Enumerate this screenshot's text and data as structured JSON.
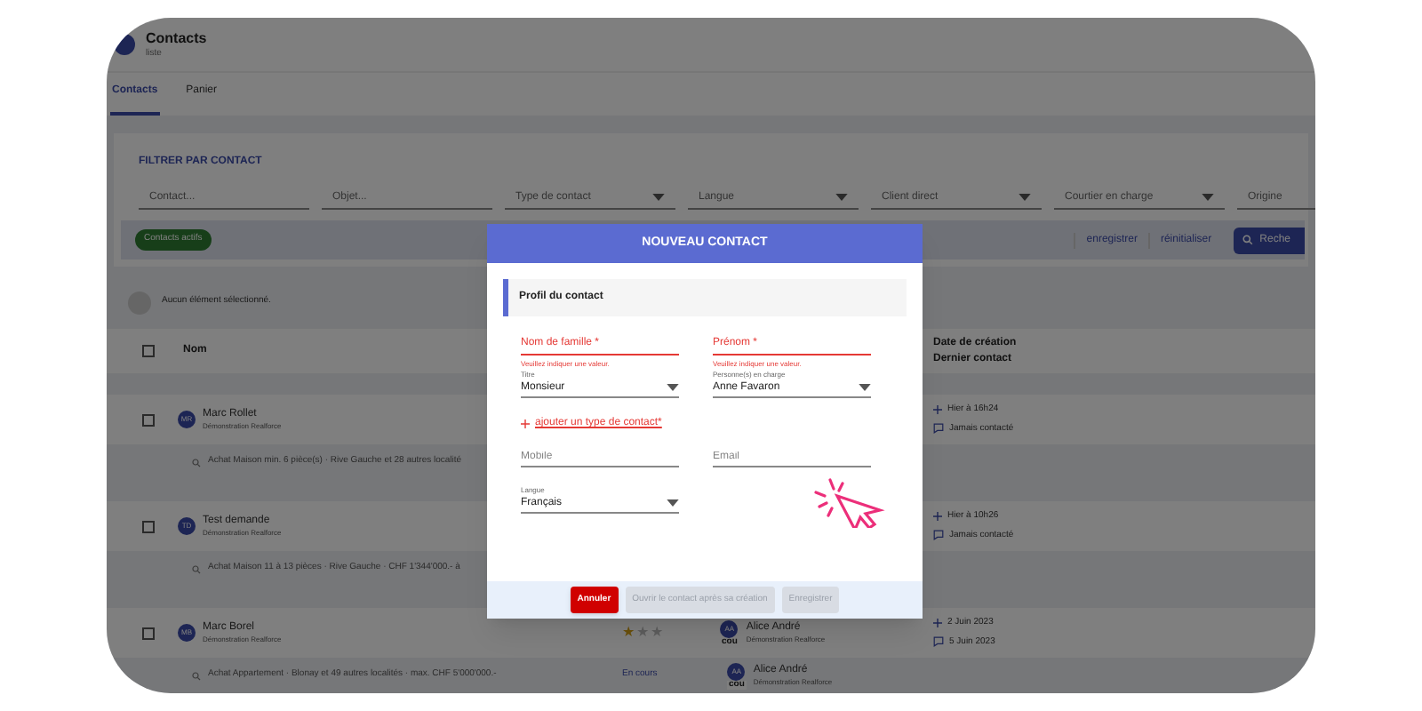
{
  "app": {
    "title": "Contacts",
    "subtitle": "liste"
  },
  "tabs": [
    {
      "label": "Contacts",
      "selected": true
    },
    {
      "label": "Panier",
      "selected": false
    }
  ],
  "filters": {
    "title": "FILTRER PAR CONTACT",
    "fields": [
      {
        "kind": "input",
        "placeholder": "Contact..."
      },
      {
        "kind": "input",
        "placeholder": "Objet..."
      },
      {
        "kind": "select",
        "placeholder": "Type de contact"
      },
      {
        "kind": "select",
        "placeholder": "Langue"
      },
      {
        "kind": "select",
        "placeholder": "Client direct"
      },
      {
        "kind": "select",
        "placeholder": "Courtier en charge"
      },
      {
        "kind": "input",
        "placeholder": "Origine"
      }
    ],
    "chip": "Contacts actifs",
    "actions": [
      "enregistrer",
      "réinitialiser"
    ],
    "search_button": "Reche"
  },
  "selection": "Aucun élément sélectionné.",
  "columns": {
    "name": "Nom",
    "date": [
      "Date de création",
      "Dernier contact"
    ]
  },
  "select_all": {
    "checked": false
  },
  "rows": [
    {
      "checked": false,
      "initials": "MR",
      "name": "Marc Rollet",
      "company": "Démonstration Realforce",
      "created": "Hier à 16h24",
      "last_contact": "Jamais contacté",
      "search": "Achat Maison min. 6 pièce(s) · Rive Gauche et 28 autres localité"
    },
    {
      "checked": false,
      "initials": "TD",
      "name": "Test demande",
      "company": "Démonstration Realforce",
      "created": "Hier à 10h26",
      "last_contact": "Jamais contacté",
      "search": "Achat Maison 11 à 13 pièces · Rive Gauche · CHF 1'344'000.- à"
    },
    {
      "checked": false,
      "initials": "MB",
      "name": "Marc Borel",
      "company": "Démonstration Realforce",
      "stars": 1,
      "broker": {
        "initials": "AA",
        "badge": "cou",
        "name": "Alice André",
        "company": "Démonstration Realforce"
      },
      "created": "2 Juin 2023",
      "last_contact": "5 Juin 2023",
      "search": "Achat Appartement · Blonay et 49 autres localités · max. CHF 5'000'000.-",
      "search_status": "En cours",
      "search_broker": {
        "initials": "AA",
        "badge": "cou",
        "name": "Alice André",
        "company": "Démonstration Realforce"
      }
    }
  ],
  "dialog": {
    "title": "NOUVEAU CONTACT",
    "section": "Profil du contact",
    "fields": [
      {
        "kind": "text",
        "label": "Nom de famille *",
        "error": "Veuillez indiquer une valeur."
      },
      {
        "kind": "text",
        "label": "Prénom *",
        "error": "Veuillez indiquer une valeur."
      },
      {
        "kind": "select",
        "label": "Titre",
        "value": "Monsieur"
      },
      {
        "kind": "select",
        "label": "Personne(s) en charge",
        "value": "Anne Favaron"
      },
      {
        "kind": "link",
        "label": "ajouter un type de contact*"
      },
      {
        "kind": "input",
        "placeholder": "Mobile"
      },
      {
        "kind": "input",
        "placeholder": "Email"
      },
      {
        "kind": "select",
        "label": "Langue",
        "value": "Français"
      }
    ],
    "buttons": [
      {
        "label": "Annuler",
        "kind": "danger",
        "disabled": false
      },
      {
        "label": "Ouvrir le contact après sa création",
        "kind": "plain",
        "disabled": true
      },
      {
        "label": "Enregistrer",
        "kind": "plain",
        "disabled": true
      }
    ]
  }
}
